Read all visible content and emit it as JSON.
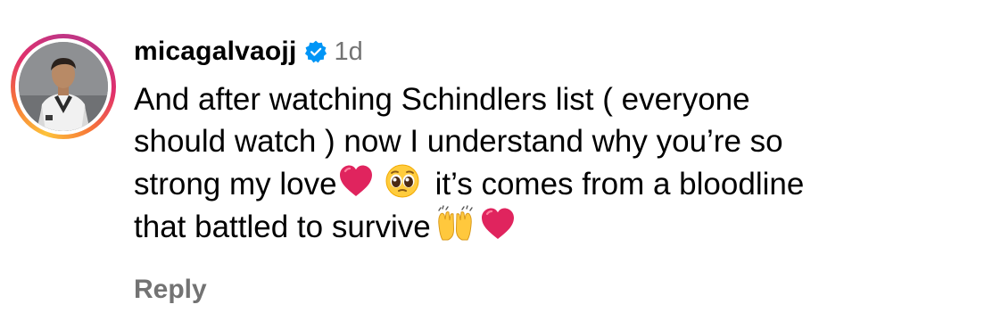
{
  "comment": {
    "username": "micagalvaojj",
    "verified_icon": "verified-badge-icon",
    "timestamp": "1d",
    "text_lines": [
      "And after watching Schindlers list ( everyone",
      "should watch ) now I understand why you’re so",
      "strong my love",
      "it’s comes from a bloodline",
      "that battled to survive"
    ],
    "emojis": [
      "heart-icon",
      "pleading-face-icon",
      "raising-hands-icon",
      "heart-icon"
    ],
    "reply_label": "Reply"
  },
  "colors": {
    "verified_blue": "#0095f6",
    "muted_gray": "#737373",
    "heart_red": "#e0245e"
  }
}
